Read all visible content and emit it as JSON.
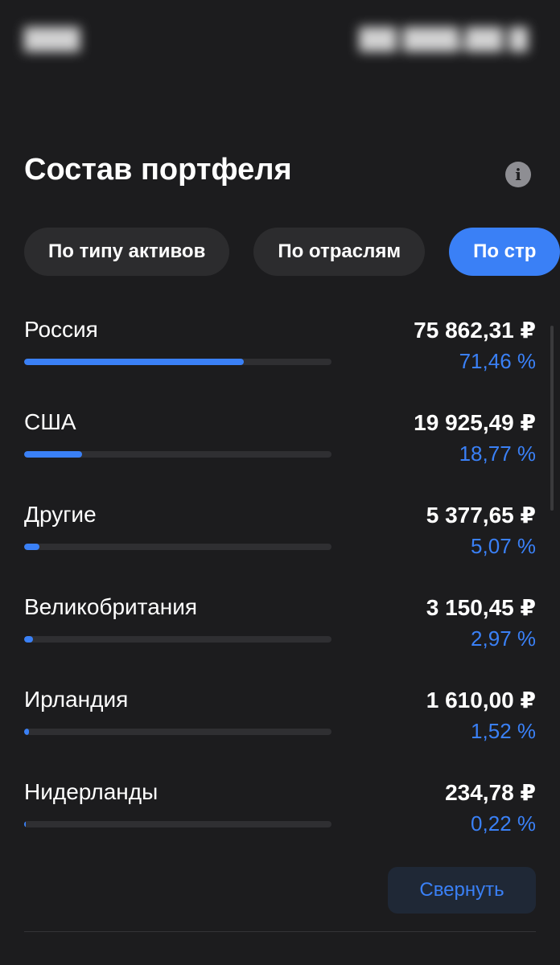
{
  "section": {
    "title": "Состав портфеля"
  },
  "tabs": [
    {
      "label": "По типу активов",
      "active": false
    },
    {
      "label": "По отраслям",
      "active": false
    },
    {
      "label": "По стр",
      "active": true
    }
  ],
  "rows": [
    {
      "country": "Россия",
      "amount": "75 862,31 ₽",
      "percent": "71,46 %",
      "share": 0.7146
    },
    {
      "country": "США",
      "amount": "19 925,49 ₽",
      "percent": "18,77 %",
      "share": 0.1877
    },
    {
      "country": "Другие",
      "amount": "5 377,65 ₽",
      "percent": "5,07 %",
      "share": 0.0507
    },
    {
      "country": "Великобритания",
      "amount": "3 150,45 ₽",
      "percent": "2,97 %",
      "share": 0.0297
    },
    {
      "country": "Ирландия",
      "amount": "1 610,00 ₽",
      "percent": "1,52 %",
      "share": 0.0152
    },
    {
      "country": "Нидерланды",
      "amount": "234,78 ₽",
      "percent": "0,22 %",
      "share": 0.0022
    }
  ],
  "collapse_button": "Свернуть",
  "icons": {
    "info": "info-icon"
  },
  "colors": {
    "accent": "#3a80f6",
    "background": "#1c1c1e",
    "tab_bg": "#2c2c2e"
  }
}
